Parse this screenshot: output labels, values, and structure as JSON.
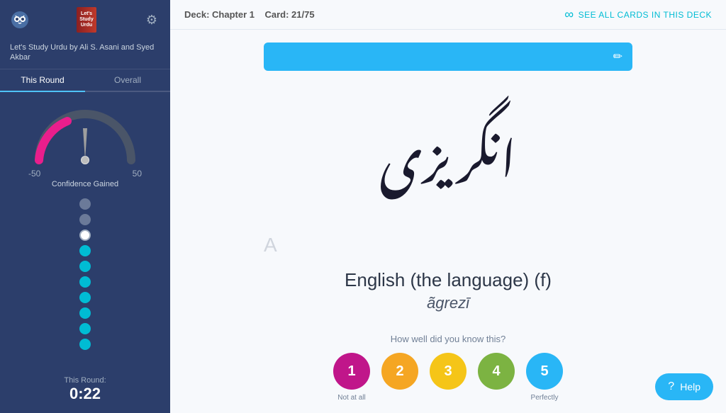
{
  "sidebar": {
    "title": "Let's Study Urdu by Ali S. Asani and Syed Akbar",
    "tabs": [
      {
        "label": "This Round",
        "active": true
      },
      {
        "label": "Overall",
        "active": false
      }
    ],
    "gauge": {
      "min_label": "-50",
      "max_label": "50",
      "value": 0,
      "confidence_label": "Confidence Gained"
    },
    "dots": [
      {
        "type": "gray"
      },
      {
        "type": "gray"
      },
      {
        "type": "white"
      },
      {
        "type": "cyan"
      },
      {
        "type": "cyan"
      },
      {
        "type": "cyan"
      },
      {
        "type": "cyan"
      },
      {
        "type": "cyan"
      },
      {
        "type": "cyan"
      },
      {
        "type": "cyan"
      }
    ],
    "timer": {
      "label": "This Round:",
      "value": "0:22"
    },
    "gear_icon": "⚙"
  },
  "topbar": {
    "deck_label": "Deck:",
    "deck_name": "Chapter 1",
    "card_label": "Card:",
    "card_value": "21/75",
    "see_all_text": "SEE ALL CARDS IN THIS DECK"
  },
  "card": {
    "urdu_text": "انگریزی",
    "english_text": "English (the language) (f)",
    "romanized_text": "ãgrezī",
    "edit_icon": "✏",
    "translation_hint": "A"
  },
  "rating": {
    "question": "How well did you know this?",
    "buttons": [
      {
        "value": "1",
        "color": "#c0168a",
        "label": "Not at all"
      },
      {
        "value": "2",
        "color": "#f5a623",
        "label": ""
      },
      {
        "value": "3",
        "color": "#f5c518",
        "label": ""
      },
      {
        "value": "4",
        "color": "#7cb342",
        "label": ""
      },
      {
        "value": "5",
        "color": "#29b6f6",
        "label": "Perfectly"
      }
    ]
  },
  "help": {
    "label": "Help",
    "icon": "?"
  }
}
